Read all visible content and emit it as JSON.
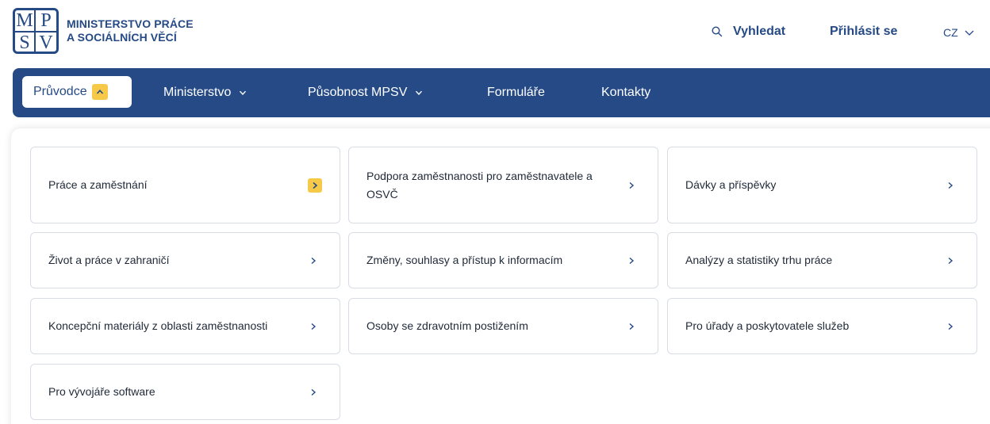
{
  "header": {
    "logo_letters": [
      "M",
      "P",
      "S",
      "V"
    ],
    "brand_line1": "MINISTERSTVO PRÁCE",
    "brand_line2": "A SOCIÁLNÍCH VĚCÍ",
    "search_label": "Vyhledat",
    "login_label": "Přihlásit se",
    "language": "CZ"
  },
  "nav": {
    "items": [
      {
        "label": "Průvodce",
        "active": true
      },
      {
        "label": "Ministerstvo"
      },
      {
        "label": "Působnost MPSV"
      },
      {
        "label": "Formuláře"
      },
      {
        "label": "Kontakty"
      }
    ]
  },
  "menu": {
    "cards": [
      {
        "label": "Práce a zaměstnání",
        "highlighted": true
      },
      {
        "label": "Podpora zaměstnanosti pro zaměstnavatele a OSVČ"
      },
      {
        "label": "Dávky a příspěvky"
      },
      {
        "label": "Život a práce v zahraničí"
      },
      {
        "label": "Změny, souhlasy a přístup k informacím"
      },
      {
        "label": "Analýzy a statistiky trhu práce"
      },
      {
        "label": "Koncepční materiály z oblasti zaměstnanosti"
      },
      {
        "label": "Osoby se zdravotním postižením"
      },
      {
        "label": "Pro úřady a poskytovatele služeb"
      },
      {
        "label": "Pro vývojáře software"
      }
    ]
  },
  "colors": {
    "brand": "#254a86",
    "accent": "#f7c948",
    "border": "#d8dde5"
  },
  "icons": {
    "search": "search-icon",
    "lang_dropdown": "chevron-down-icon",
    "card_arrow": "chevron-right-icon"
  }
}
